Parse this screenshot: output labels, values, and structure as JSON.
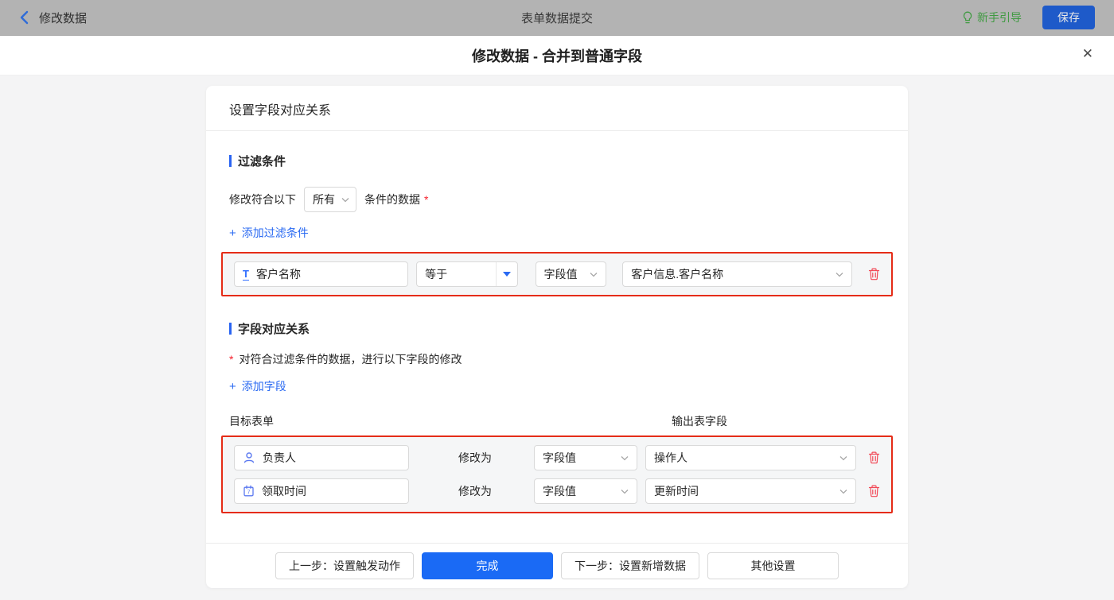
{
  "topbar": {
    "back_label": "修改数据",
    "title": "表单数据提交",
    "guide_label": "新手引导",
    "save_label": "保存"
  },
  "modal": {
    "title": "修改数据 - 合并到普通字段",
    "close_glyph": "✕"
  },
  "card": {
    "header_title": "设置字段对应关系",
    "filter": {
      "section_title": "过滤条件",
      "prefix": "修改符合以下",
      "scope_value": "所有",
      "suffix": "条件的数据",
      "required_mark": "*",
      "add_icon": "+",
      "add_label": "添加过滤条件",
      "rows": [
        {
          "field": "客户名称",
          "operator": "等于",
          "value_type": "字段值",
          "value": "客户信息.客户名称"
        }
      ]
    },
    "mapping": {
      "section_title": "字段对应关系",
      "required_mark": "*",
      "description": "对符合过滤条件的数据，进行以下字段的修改",
      "add_icon": "+",
      "add_label": "添加字段",
      "col_target": "目标表单",
      "col_output": "输出表字段",
      "rows": [
        {
          "field": "负责人",
          "modify_label": "修改为",
          "value_type": "字段值",
          "value": "操作人"
        },
        {
          "field": "领取时间",
          "modify_label": "修改为",
          "value_type": "字段值",
          "value": "更新时间"
        }
      ]
    },
    "footer": {
      "prev_label": "上一步：设置触发动作",
      "done_label": "完成",
      "next_label": "下一步：设置新增数据",
      "other_label": "其他设置"
    }
  },
  "icons": {
    "text_field_glyph": "T",
    "calendar_day": "7"
  },
  "colors": {
    "accent_blue": "#1a6af5",
    "link_blue": "#2a6af2",
    "highlight_red": "#e52c17",
    "trash_red": "#f24957",
    "guide_green": "#3f9a41"
  }
}
